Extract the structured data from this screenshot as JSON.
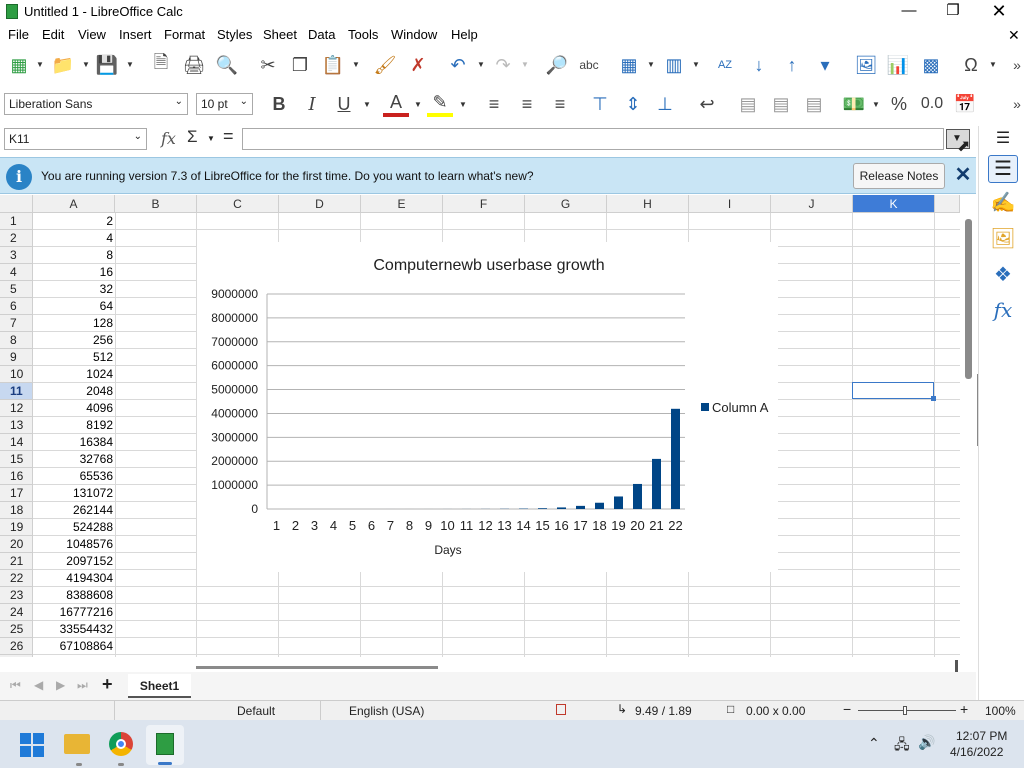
{
  "window": {
    "title": "Untitled 1 - LibreOffice Calc"
  },
  "menu": [
    "File",
    "Edit",
    "View",
    "Insert",
    "Format",
    "Styles",
    "Sheet",
    "Data",
    "Tools",
    "Window",
    "Help"
  ],
  "font": {
    "name": "Liberation Sans",
    "size": "10 pt"
  },
  "namebox": {
    "value": "K11"
  },
  "formula": {
    "fx": "fx",
    "sigma": "Σ",
    "equals": "="
  },
  "infobar": {
    "message": "You are running version 7.3 of LibreOffice for the first time. Do you want to learn what's new?",
    "button": "Release Notes"
  },
  "columns": [
    "A",
    "B",
    "C",
    "D",
    "E",
    "F",
    "G",
    "H",
    "I",
    "J",
    "K"
  ],
  "rows": [
    "1",
    "2",
    "3",
    "4",
    "5",
    "6",
    "7",
    "8",
    "9",
    "10",
    "11",
    "12",
    "13",
    "14",
    "15",
    "16",
    "17",
    "18",
    "19",
    "20",
    "21",
    "22",
    "23",
    "24",
    "25",
    "26"
  ],
  "colA": [
    "2",
    "4",
    "8",
    "16",
    "32",
    "64",
    "128",
    "256",
    "512",
    "1024",
    "2048",
    "4096",
    "8192",
    "16384",
    "32768",
    "65536",
    "131072",
    "262144",
    "524288",
    "1048576",
    "2097152",
    "4194304",
    "8388608",
    "16777216",
    "33554432",
    "67108864"
  ],
  "chart_data": {
    "type": "bar",
    "title": "Computernewb userbase growth",
    "xlabel": "Days",
    "ylabel": "",
    "categories": [
      "1",
      "2",
      "3",
      "4",
      "5",
      "6",
      "7",
      "8",
      "9",
      "10",
      "11",
      "12",
      "13",
      "14",
      "15",
      "16",
      "17",
      "18",
      "19",
      "20",
      "21",
      "22"
    ],
    "series": [
      {
        "name": "Column A",
        "values": [
          2,
          4,
          8,
          16,
          32,
          64,
          128,
          256,
          512,
          1024,
          2048,
          4096,
          8192,
          16384,
          32768,
          65536,
          131072,
          262144,
          524288,
          1048576,
          2097152,
          4194304
        ]
      }
    ],
    "ylim": [
      0,
      9000000
    ],
    "yticks": [
      "0",
      "1000000",
      "2000000",
      "3000000",
      "4000000",
      "5000000",
      "6000000",
      "7000000",
      "8000000",
      "9000000"
    ],
    "grid": true,
    "legend": "right",
    "color": "#004586"
  },
  "sheet": {
    "tab": "Sheet1"
  },
  "status": {
    "style": "Default",
    "language": "English (USA)",
    "position": "9.49 / 1.89",
    "size": "0.00 x 0.00",
    "zoom": "100%"
  },
  "taskbar": {
    "time": "12:07 PM",
    "date": "4/16/2022"
  }
}
